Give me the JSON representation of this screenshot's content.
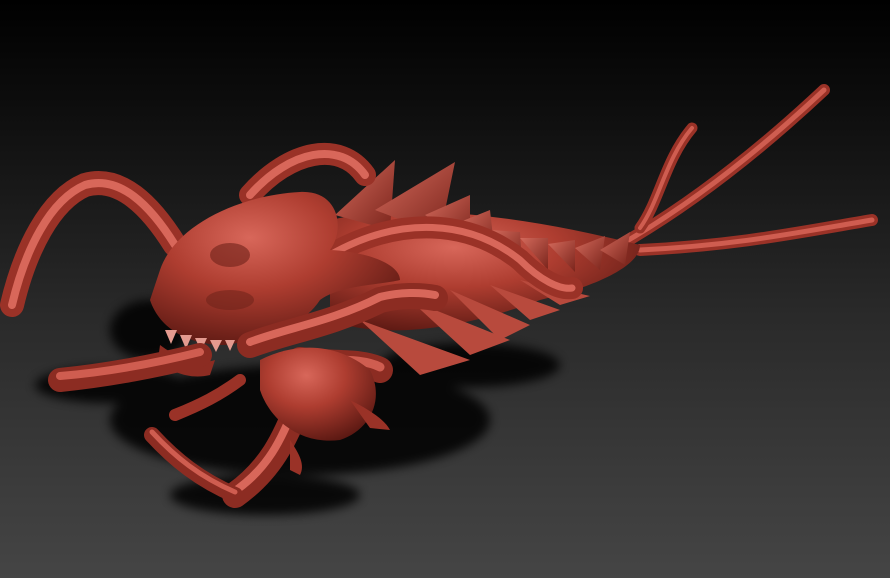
{
  "viewport": {
    "background_top": "#000000",
    "background_bottom": "#454545"
  },
  "sculpt": {
    "subject": "creature-sculpt",
    "material_color": "#a8362b",
    "highlight_color": "#d8675a",
    "shadow_color": "#000000"
  }
}
